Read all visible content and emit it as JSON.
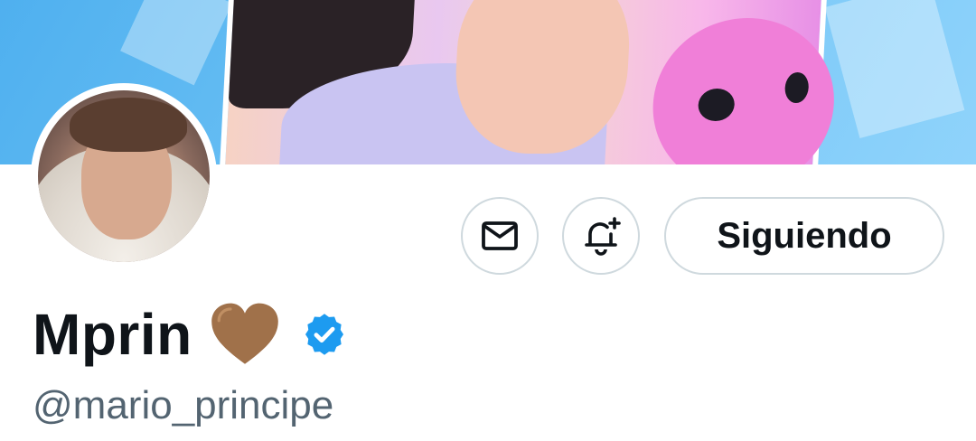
{
  "profile": {
    "display_name": "Mprin",
    "name_emoji": "brown-heart-icon",
    "verified_badge": "verified-badge-icon",
    "handle": "@mario_principe"
  },
  "actions": {
    "message_icon": "mail-icon",
    "notify_icon": "bell-plus-icon",
    "follow_label": "Siguiendo"
  },
  "colors": {
    "text_primary": "#0f1419",
    "text_secondary": "#536471",
    "border": "#cfd9de",
    "verified_blue": "#1d9bf0",
    "heart_brown": "#a0714a",
    "banner_blue": "#4fb0ef"
  }
}
